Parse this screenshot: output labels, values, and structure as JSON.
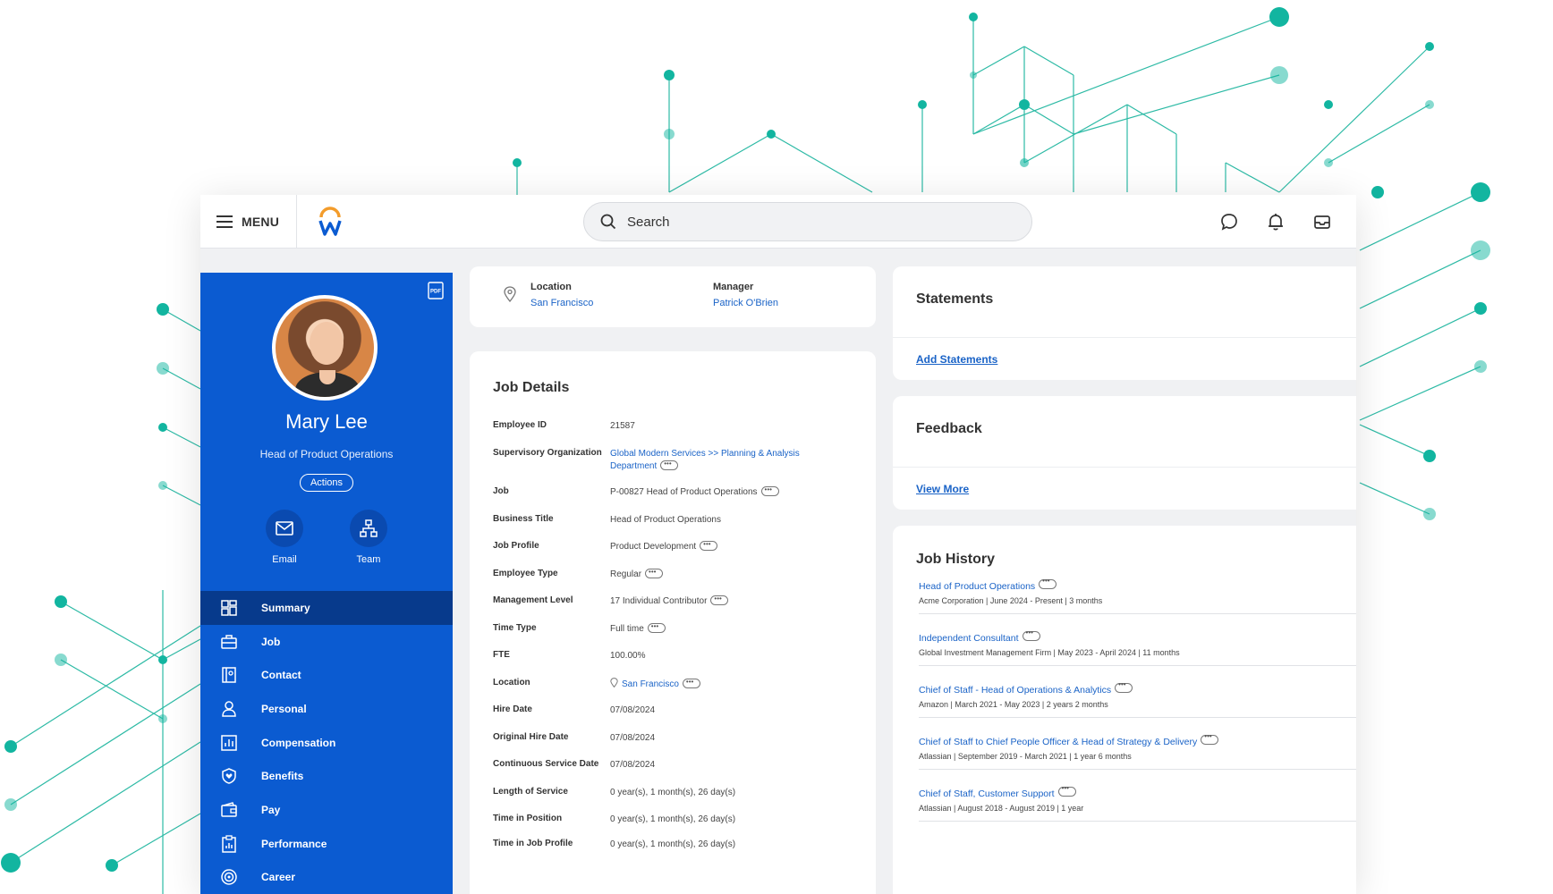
{
  "topbar": {
    "menu_label": "MENU",
    "search_placeholder": "Search"
  },
  "profile": {
    "name": "Mary Lee",
    "title": "Head of Product Operations",
    "actions_label": "Actions",
    "quick_actions": [
      {
        "label": "Email",
        "icon": "mail-icon"
      },
      {
        "label": "Team",
        "icon": "org-chart-icon"
      }
    ]
  },
  "nav": {
    "items": [
      {
        "label": "Summary",
        "icon": "grid-icon",
        "active": true
      },
      {
        "label": "Job",
        "icon": "briefcase-icon"
      },
      {
        "label": "Contact",
        "icon": "contact-book-icon"
      },
      {
        "label": "Personal",
        "icon": "person-icon"
      },
      {
        "label": "Compensation",
        "icon": "bar-chart-icon"
      },
      {
        "label": "Benefits",
        "icon": "shield-heart-icon"
      },
      {
        "label": "Pay",
        "icon": "wallet-icon"
      },
      {
        "label": "Performance",
        "icon": "clipboard-chart-icon"
      },
      {
        "label": "Career",
        "icon": "target-icon"
      }
    ]
  },
  "location_card": {
    "location_label": "Location",
    "location_value": "San Francisco",
    "manager_label": "Manager",
    "manager_value": "Patrick O'Brien"
  },
  "job_details": {
    "heading": "Job Details",
    "rows": [
      {
        "key": "Employee ID",
        "value": "21587"
      },
      {
        "key": "Supervisory Organization",
        "value": "Global Modern Services >> Planning & Analysis Department"
      },
      {
        "key": "Job",
        "value": "P-00827 Head of Product Operations"
      },
      {
        "key": "Business Title",
        "value": "Head of Product Operations"
      },
      {
        "key": "Job Profile",
        "value": "Product Development"
      },
      {
        "key": "Employee Type",
        "value": "Regular"
      },
      {
        "key": "Management Level",
        "value": "17 Individual Contributor"
      },
      {
        "key": "Time Type",
        "value": "Full time"
      },
      {
        "key": "FTE",
        "value": "100.00%"
      },
      {
        "key": "Location",
        "value": "San Francisco"
      },
      {
        "key": "Hire Date",
        "value": "07/08/2024"
      },
      {
        "key": "Original Hire Date",
        "value": "07/08/2024"
      },
      {
        "key": "Continuous Service Date",
        "value": "07/08/2024"
      },
      {
        "key": "Length of Service",
        "value": "0 year(s), 1 month(s), 26 day(s)"
      },
      {
        "key": "Time in Position",
        "value": "0 year(s), 1 month(s), 26 day(s)"
      },
      {
        "key": "Time in Job Profile",
        "value": "0 year(s), 1 month(s), 26 day(s)"
      }
    ]
  },
  "statements": {
    "heading": "Statements",
    "link": "Add Statements"
  },
  "feedback": {
    "heading": "Feedback",
    "link": "View More"
  },
  "job_history": {
    "heading": "Job History",
    "items": [
      {
        "title": "Head of Product Operations",
        "sub": "Acme Corporation | June 2024 - Present | 3 months"
      },
      {
        "title": "Independent Consultant",
        "sub": "Global Investment Management Firm | May 2023 - April 2024 | 11 months"
      },
      {
        "title": "Chief of Staff - Head of Operations & Analytics",
        "sub": "Amazon | March 2021 - May 2023 | 2 years 2 months"
      },
      {
        "title": "Chief of Staff to Chief People Officer & Head of Strategy & Delivery",
        "sub": "Atlassian | September 2019 - March 2021 | 1 year 6 months"
      },
      {
        "title": "Chief of Staff, Customer Support",
        "sub": "Atlassian | August 2018 - August 2019 | 1 year"
      }
    ]
  },
  "colors": {
    "brand_blue": "#0b5bd1",
    "nav_active": "#073a8c",
    "link_blue": "#1a63c7",
    "teal_accent": "#12b5a0"
  }
}
